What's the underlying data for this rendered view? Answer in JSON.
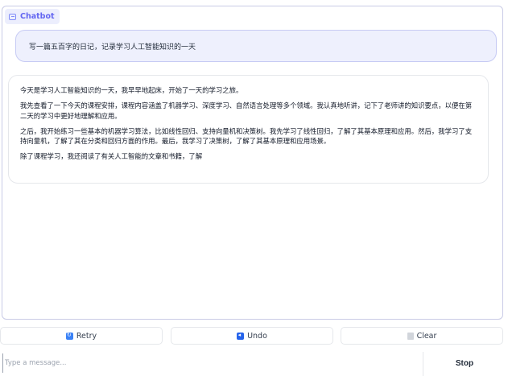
{
  "chatbot": {
    "label": "Chatbot",
    "label_icon": "chat-icon",
    "user_message": "写一篇五百字的日记，记录学习人工智能知识的一天",
    "bot_paragraphs": [
      "今天是学习人工智能知识的一天，我早早地起床，开始了一天的学习之旅。",
      "我先查看了一下今天的课程安排，课程内容涵盖了机器学习、深度学习、自然语言处理等多个领域。我认真地听讲，记下了老师讲的知识要点，以便在第二天的学习中更好地理解和应用。",
      "之后，我开始练习一些基本的机器学习算法，比如线性回归、支持向量机和决策树。我先学习了线性回归，了解了其基本原理和应用。然后，我学习了支持向量机，了解了其在分类和回归方面的作用。最后，我学习了决策树，了解了其基本原理和应用场景。",
      "除了课程学习，我还阅读了有关人工智能的文章和书籍，了解"
    ]
  },
  "actions": {
    "retry_label": "Retry",
    "undo_label": "Undo",
    "clear_label": "Clear",
    "retry_icon": "retry-icon",
    "undo_icon": "undo-icon",
    "clear_icon": "trash-icon"
  },
  "composer": {
    "placeholder": "Type a message...",
    "value": "",
    "stop_label": "Stop"
  },
  "colors": {
    "accent": "#6366f1",
    "user_bubble_bg": "#eef0fd",
    "panel_border": "#c9cbe6"
  }
}
